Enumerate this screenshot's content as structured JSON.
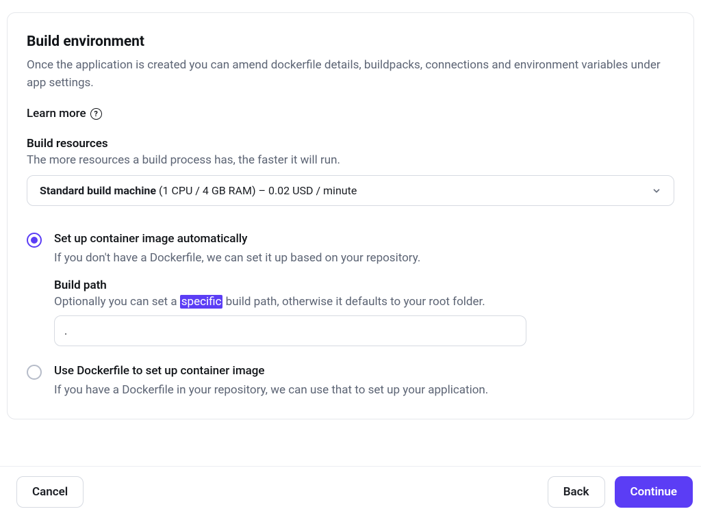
{
  "heading": "Build environment",
  "description": "Once the application is created you can amend dockerfile details, buildpacks, connections and environment variables under app settings.",
  "learn_more_label": "Learn more",
  "build_resources": {
    "label": "Build resources",
    "sub": "The more resources a build process has, the faster it will run.",
    "selected_strong": "Standard build machine",
    "selected_rest": " (1 CPU / 4 GB RAM) – 0.02 USD / minute"
  },
  "options": {
    "auto": {
      "title": "Set up container image automatically",
      "desc": "If you don't have a Dockerfile, we can set it up based on your repository.",
      "build_path_label": "Build path",
      "build_path_sub_pre": "Optionally you can set a ",
      "build_path_sub_hl": "specific",
      "build_path_sub_post": " build path, otherwise it defaults to your root folder.",
      "build_path_value": "."
    },
    "dockerfile": {
      "title": "Use Dockerfile to set up container image",
      "desc": "If you have a Dockerfile in your repository, we can use that to set up your application."
    }
  },
  "footer": {
    "cancel": "Cancel",
    "back": "Back",
    "continue": "Continue"
  }
}
